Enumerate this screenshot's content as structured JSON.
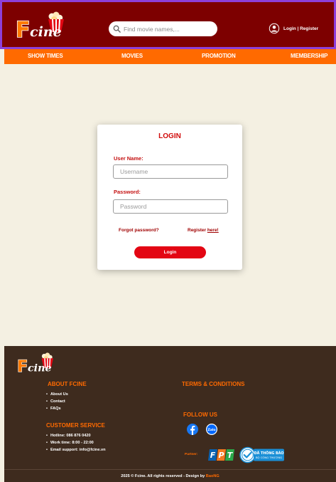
{
  "header": {
    "logo_text": "Fcine",
    "search_placeholder": "Find movie names,...",
    "account_label": "Login | Register"
  },
  "nav": {
    "items": [
      "SHOW TIMES",
      "MOVIES",
      "PROMOTION",
      "MEMBERSHIP"
    ]
  },
  "login": {
    "title": "LOGIN",
    "username_label": "User Name:",
    "username_placeholder": "Username",
    "password_label": "Password:",
    "password_placeholder": "Password",
    "forgot_password": "Forgot password?",
    "register_prefix": "Register ",
    "register_link": "here!",
    "submit": "Login"
  },
  "footer": {
    "about": {
      "heading": "ABOUT FCINE",
      "items": [
        "About Us",
        "Contact",
        "FAQs"
      ]
    },
    "customer_service": {
      "heading": "CUSTOMER SERVICE",
      "items": [
        "Hotline: 086 876 0420",
        "Work time: 8:00 - 22:00",
        "Email support: info@fcine.vn"
      ]
    },
    "terms_heading": "TERMS & CONDITIONS",
    "follow_heading": "FOLLOW US",
    "social": [
      "facebook-icon",
      "zalo-icon"
    ],
    "zalo_text": "Zalo",
    "partner_label": "Partner:",
    "partner_fpt": "FPT",
    "badge_line1": "ĐÃ THÔNG BÁO",
    "badge_line2": "BỘ CÔNG THƯƠNG",
    "copyright_prefix": "2025 © Fcine. All rights reserved - Design by ",
    "copyright_author": "BaoNG"
  },
  "colors": {
    "header_bg": "#7d0000",
    "nav_bg": "#ff6a00",
    "accent_red": "#e30613",
    "footer_bg": "#3e2b1e",
    "footer_heading": "#ff6a00"
  }
}
